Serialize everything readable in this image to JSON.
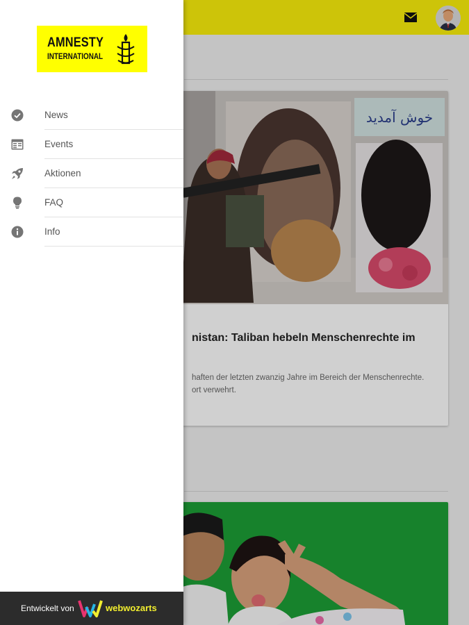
{
  "header": {
    "mail_icon": "mail-icon",
    "avatar_icon": "user-avatar"
  },
  "feed": {
    "articles": [
      {
        "title": "nistan: Taliban hebeln Menschenrechte im",
        "teaser_line1": "haften der letzten zwanzig Jahre im Bereich der Menschenrechte.",
        "teaser_line2": "ort verwehrt.",
        "image": "taliban-fighter-photo"
      },
      {
        "image": "smiling-children-photo"
      }
    ]
  },
  "drawer": {
    "logo": {
      "line1": "AMNESTY",
      "line2": "INTERNATIONAL"
    },
    "items": [
      {
        "label": "News",
        "icon": "check-circle-icon"
      },
      {
        "label": "Events",
        "icon": "calendar-icon"
      },
      {
        "label": "Aktionen",
        "icon": "rocket-icon"
      },
      {
        "label": "FAQ",
        "icon": "lightbulb-icon"
      },
      {
        "label": "Info",
        "icon": "info-icon"
      }
    ],
    "footer": {
      "prefix": "Entwickelt von",
      "brand": "webwozarts"
    }
  },
  "colors": {
    "brand_yellow": "#ffff00",
    "header_yellow": "#f7ec0c",
    "footer_bg": "#2c2c2c",
    "icon_grey": "#757575"
  }
}
